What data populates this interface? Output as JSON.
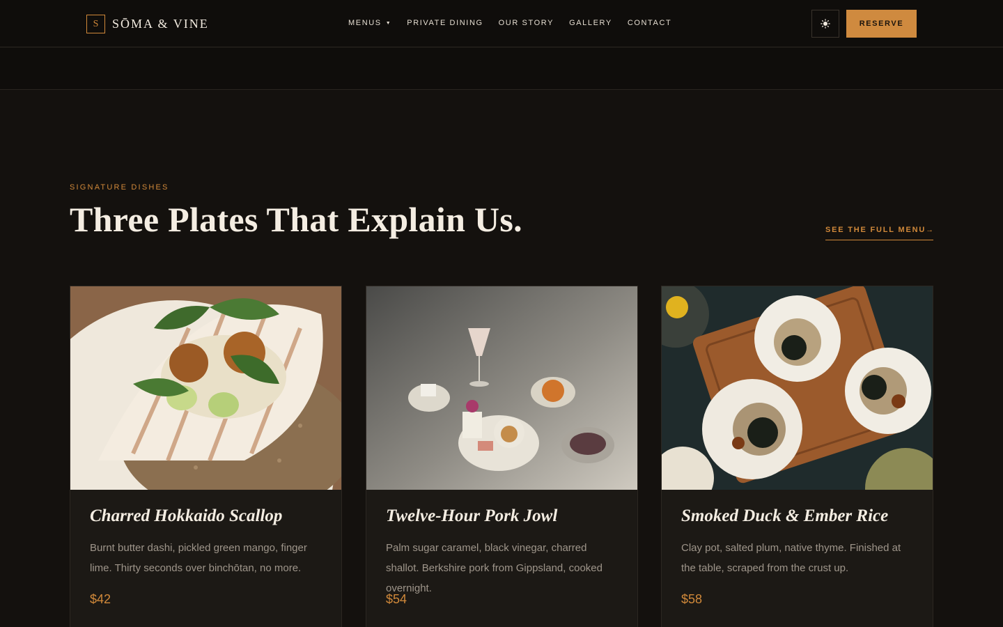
{
  "brand": {
    "mark": "S",
    "name": "SŌMA & VINE"
  },
  "nav": {
    "links": [
      {
        "label": "MENUS",
        "has_dropdown": true
      },
      {
        "label": "PRIVATE DINING"
      },
      {
        "label": "OUR STORY"
      },
      {
        "label": "GALLERY"
      },
      {
        "label": "CONTACT"
      }
    ],
    "theme_icon": "sun-icon",
    "reserve_label": "RESERVE"
  },
  "section": {
    "eyebrow": "SIGNATURE DISHES",
    "headline": "Three Plates That Explain Us.",
    "full_menu_link": "SEE THE FULL MENU→"
  },
  "dishes": [
    {
      "title": "Charred Hokkaido Scallop",
      "description": "Burnt butter dashi, pickled green mango, finger lime. Thirty seconds over binchōtan, no more.",
      "price": "$42",
      "image": "scallop-in-shell-photo"
    },
    {
      "title": "Twelve-Hour Pork Jowl",
      "description": "Palm sugar caramel, black vinegar, charred shallot. Berkshire pork from Gippsland, cooked overnight.",
      "price": "$54",
      "image": "plated-tasting-dishes-photo"
    },
    {
      "title": "Smoked Duck & Ember Rice",
      "description": "Clay pot, salted plum, native thyme. Finished at the table, scraped from the crust up.",
      "price": "$58",
      "image": "scallops-on-board-photo"
    }
  ],
  "colors": {
    "accent": "#d1893a",
    "background": "#14110e",
    "card": "#1c1915",
    "text": "#f2ebe0",
    "muted": "#9e958a"
  }
}
